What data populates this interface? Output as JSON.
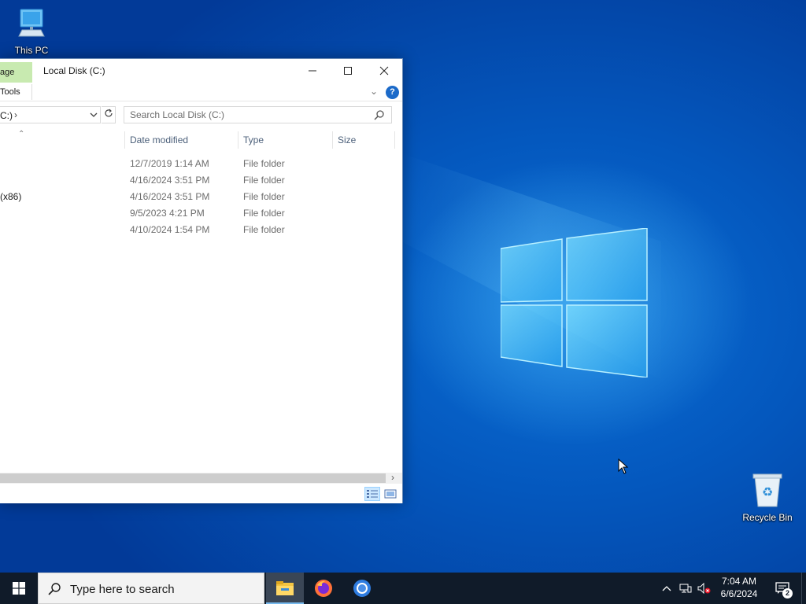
{
  "desktop": {
    "icons": [
      {
        "label": "This PC",
        "icon": "computer-icon"
      },
      {
        "label": "Recycle Bin",
        "icon": "recycle-bin-icon"
      }
    ]
  },
  "explorer": {
    "title": "Local Disk (C:)",
    "ribbon": {
      "manage_tab": "age",
      "tools_label": "Tools",
      "help_label": "?"
    },
    "address": {
      "path_fragment": "C:)",
      "separator": "›"
    },
    "search": {
      "placeholder": "Search Local Disk (C:)"
    },
    "columns": {
      "date_modified": "Date modified",
      "type": "Type",
      "size": "Size"
    },
    "rows": [
      {
        "name": "",
        "date": "12/7/2019 1:14 AM",
        "type": "File folder"
      },
      {
        "name": "",
        "date": "4/16/2024 3:51 PM",
        "type": "File folder"
      },
      {
        "name": "(x86)",
        "date": "4/16/2024 3:51 PM",
        "type": "File folder"
      },
      {
        "name": "",
        "date": "9/5/2023 4:21 PM",
        "type": "File folder"
      },
      {
        "name": "",
        "date": "4/10/2024 1:54 PM",
        "type": "File folder"
      }
    ]
  },
  "taskbar": {
    "search_placeholder": "Type here to search",
    "pinned": [
      "file-explorer-icon",
      "firefox-icon",
      "chrome-icon"
    ],
    "clock": {
      "time": "7:04 AM",
      "date": "6/6/2024"
    },
    "notifications_count": "2"
  },
  "colors": {
    "accent": "#1b6ac9",
    "taskbar": "#101b29",
    "manage_tab": "#c8eab0",
    "desktop_blue": "#0457bd"
  }
}
